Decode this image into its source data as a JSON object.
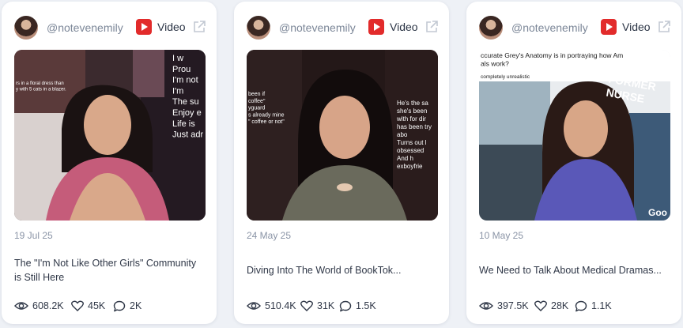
{
  "cards": [
    {
      "handle": "@notevenemily",
      "platform": "Video",
      "date": "19 Jul 25",
      "title": "The \"I'm Not Like Other Girls\" Community is Still Here",
      "views": "608.2K",
      "likes": "45K",
      "comments": "2K",
      "thumb_text": {
        "left": "rs in a floral dress than\ny with 5 cats in a blazer.",
        "right": "I w\nProu\nI'm not\nI'm\nThe su\nEnjoy e\nLife is\nJust adr"
      }
    },
    {
      "handle": "@notevenemily",
      "platform": "Video",
      "date": "24 May 25",
      "title": "Diving Into The World of BookTok...",
      "views": "510.4K",
      "likes": "31K",
      "comments": "1.5K",
      "thumb_text": {
        "left": "been if\ncoffee\"\nyguard\n\ns already mine\n\" coffee or not\"",
        "right": "He's the sa\nshe's been\nwith for dir\nhas been try\nabo\n\nTurns out l\nobsessed\n\nAnd h\nexboyfrie"
      }
    },
    {
      "handle": "@notevenemily",
      "platform": "Video",
      "date": "10 May 25",
      "title": "We Need to Talk About Medical Dramas...",
      "views": "397.5K",
      "likes": "28K",
      "comments": "1.1K",
      "thumb_text": {
        "top": "ccurate Grey's Anatomy is in portraying how Am\nals work?",
        "sub": "completely unrealistic",
        "callout": "FORMER\nNURSE",
        "corner": "Goo"
      }
    }
  ],
  "colors": {
    "background": "#eef1f6",
    "card": "#ffffff",
    "youtube_red": "#e22b2b",
    "muted_text": "#8a94a6"
  },
  "icons": {
    "platform": "youtube-icon",
    "external": "external-link-icon",
    "views": "eye-icon",
    "likes": "heart-icon",
    "comments": "comment-icon"
  }
}
